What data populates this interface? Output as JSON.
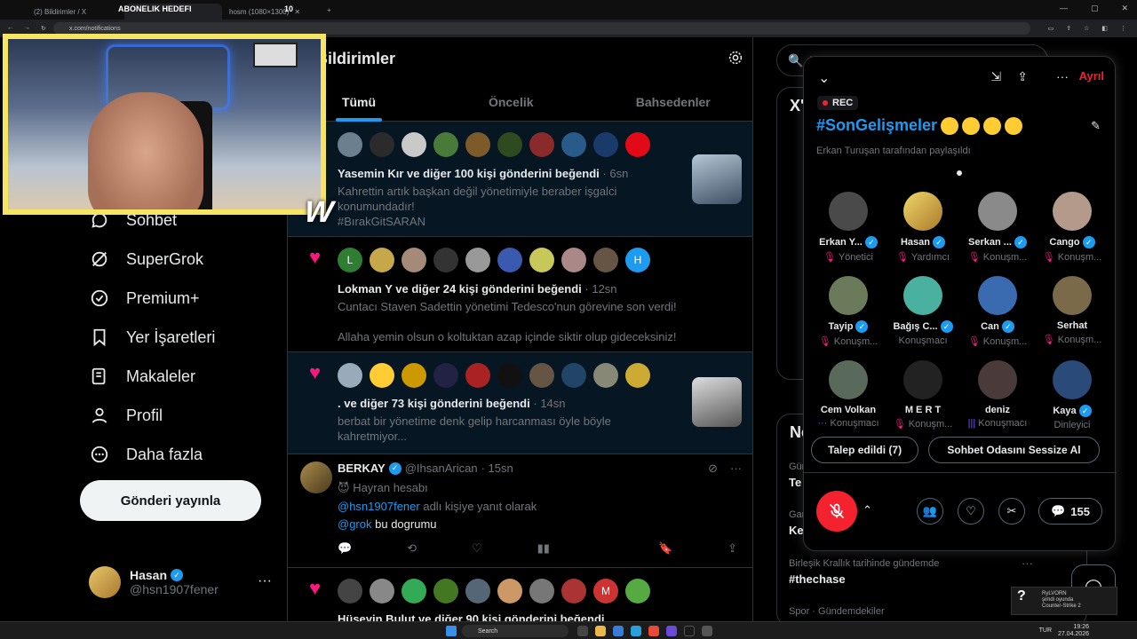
{
  "browser": {
    "tab1": "(2) Bildirimler / X",
    "tab_overlay": "ABONELIK HEDEFI",
    "tab2": "hosm (1080×1300)",
    "tab_overlay2": "10",
    "url": "x.com/notifications"
  },
  "left_nav": {
    "items": [
      {
        "label": "Sohbet",
        "icon": "chat-icon"
      },
      {
        "label": "SuperGrok",
        "icon": "grok-icon"
      },
      {
        "label": "Premium+",
        "icon": "premium-icon"
      },
      {
        "label": "Yer İşaretleri",
        "icon": "bookmark-icon"
      },
      {
        "label": "Makaleler",
        "icon": "article-icon"
      },
      {
        "label": "Profil",
        "icon": "profile-icon"
      },
      {
        "label": "Daha fazla",
        "icon": "more-icon"
      }
    ],
    "post_button": "Gönderi yayınla",
    "profile": {
      "name": "Hasan",
      "handle": "@hsn1907fener",
      "more": "···"
    }
  },
  "main": {
    "title": "Bildirimler",
    "tabs": [
      "Tümü",
      "Öncelik",
      "Bahsedenler"
    ],
    "notifications": [
      {
        "title": "Yasemin Kır ve diğer 100 kişi gönderini beğendi",
        "time": "6sn",
        "line1": "Kahrettin artık başkan değil yönetimiyle beraber işgalci",
        "line2": "konumundadır!",
        "line3": "#BırakGitSARAN"
      },
      {
        "title": "Lokman Y ve diğer 24 kişi gönderini beğendi",
        "time": "12sn",
        "line1": "Cuntacı Staven Sadettin yönetimi Tedesco'nun görevine son verdi!",
        "line2": "Allaha yemin olsun o koltuktan azap içinde siktir olup gideceksiniz!"
      },
      {
        "title": ". ve diğer 73 kişi gönderini beğendi",
        "time": "14sn",
        "line1": "berbat bir yönetime denk gelip harcanması öyle böyle",
        "line2": "kahretmiyor..."
      }
    ],
    "reply": {
      "name": "BERKAY",
      "handle": "@IhsanArican",
      "time": "· 15sn",
      "badge": "Hayran hesabı",
      "reply_to_link": "@hsn1907fener",
      "reply_to_text": "adlı kişiye yanıt olarak",
      "mention": "@grok",
      "text": "bu dogrumu"
    },
    "last_notif_title": "Hüseyin Bulut ve diğer 90 kişi gönderini beğendi"
  },
  "right": {
    "search_placeholder": "Ara",
    "trend_header": "X'te",
    "news_header": "Ne oluyor",
    "trends": [
      {
        "meta": "Gündem",
        "tag": "Te"
      },
      {
        "meta": "Gaming",
        "tag": "Ke"
      },
      {
        "meta": "Birleşik Krallık tarihinde gündemde",
        "tag": "#thechase"
      },
      {
        "meta": "Spor · Gündemdekiler",
        "tag": ""
      }
    ]
  },
  "space": {
    "leave": "Ayrıl",
    "rec": "REC",
    "title": "#SonGelişmeler",
    "shared": "Erkan Turuşan tarafından paylaşıldı",
    "people": [
      {
        "name": "Erkan Y...",
        "role": "Yönetici",
        "verified": true
      },
      {
        "name": "Hasan",
        "role": "Yardımcı",
        "verified": true
      },
      {
        "name": "Serkan ...",
        "role": "Konuşm...",
        "verified": true
      },
      {
        "name": "Cango",
        "role": "Konuşm...",
        "verified": true
      },
      {
        "name": "Tayip",
        "role": "Konuşm...",
        "verified": true
      },
      {
        "name": "Bağış C...",
        "role": "Konuşmacı",
        "verified": true
      },
      {
        "name": "Can",
        "role": "Konuşm...",
        "verified": true
      },
      {
        "name": "Serhat",
        "role": "Konuşm...",
        "verified": false
      },
      {
        "name": "Cem Volkan",
        "role": "Konuşmacı",
        "verified": false
      },
      {
        "name": "M E R T",
        "role": "Konuşm...",
        "verified": false
      },
      {
        "name": "deniz",
        "role": "Konuşmacı",
        "verified": false
      },
      {
        "name": "Kaya",
        "role": "Dinleyici",
        "verified": true
      }
    ],
    "request_button": "Talep edildi (7)",
    "mute_button": "Sohbet Odasını Sessize Al",
    "comment_count": "155"
  },
  "taskbar": {
    "search": "Search",
    "lang": "TUR",
    "time": "19:26",
    "date": "27.04.2026",
    "toast_line1": "RyLVORN",
    "toast_line2": "şimdi oyunda",
    "toast_line3": "Counter-Strike 2"
  }
}
